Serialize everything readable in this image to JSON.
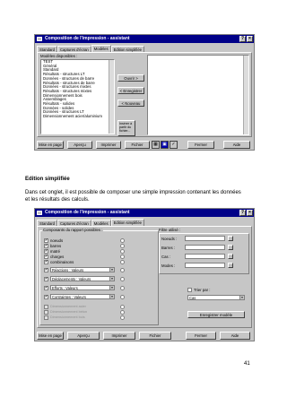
{
  "window1": {
    "title": "Composition de l'impression - assistant",
    "tabs": [
      "Standard",
      "Captures d'écran",
      "Modèles",
      "Edition simplifiée"
    ],
    "models_label": "Modèles disponibles :",
    "models": [
      "TEST",
      "Général",
      "Standard",
      "Résultats - structures LT",
      "Données - structures de barre",
      "Résultats - structures de barre",
      "Données - structures mixtes",
      "Résultats - structures mixtes",
      "Dimensionnement bois",
      "Assemblages",
      "Résultats - solides",
      "Données - solides",
      "Données - structures LT",
      "Dimensionnement acier/aluminium"
    ],
    "buttons": {
      "ouvrir": "Ouvrir >",
      "enregistrer": "< Enregistrer",
      "nouveau": "< Nouveau",
      "inviter": "Insérer à partir du fichier..."
    }
  },
  "bottom_buttons": {
    "mise": "Mise en page",
    "apercu": "Aperçu",
    "imprimer": "Imprimer",
    "fichier": "Fichier",
    "fermer": "Fermer",
    "aide": "Aide"
  },
  "caption": {
    "title": "Edition simplifiée",
    "body_line1": "Dans cet onglet, il est possible de composer une simple impression contenant les données",
    "body_line2": "et les résultats des calculs."
  },
  "window2": {
    "title": "Composition de l'impression - assistant",
    "tabs": [
      "Standard",
      "Captures d'écran",
      "Modèles",
      "Edition simplifiée"
    ],
    "components_label": "Composants du rapport possibles :",
    "checks": [
      "noeuds",
      "barres",
      "matré",
      "charges",
      "combinaisons"
    ],
    "combos": [
      "Réactions : Valeurs",
      "Déplacements : Valeurs",
      "Efforts : Valeurs",
      "Contraintes : Valeurs"
    ],
    "disabled_checks": [
      "Dimensionnement acier",
      "Dimensionnement béton",
      "Dimensionnement bois"
    ],
    "filter_label": "Filtre utilisé :",
    "fields": [
      "Noeuds :",
      "Barres :",
      "Cas :",
      "Modes :"
    ],
    "trier": "Trier par :",
    "trier_value": "Cas",
    "save_model": "Enregistrer modèle"
  },
  "page_number": "41"
}
